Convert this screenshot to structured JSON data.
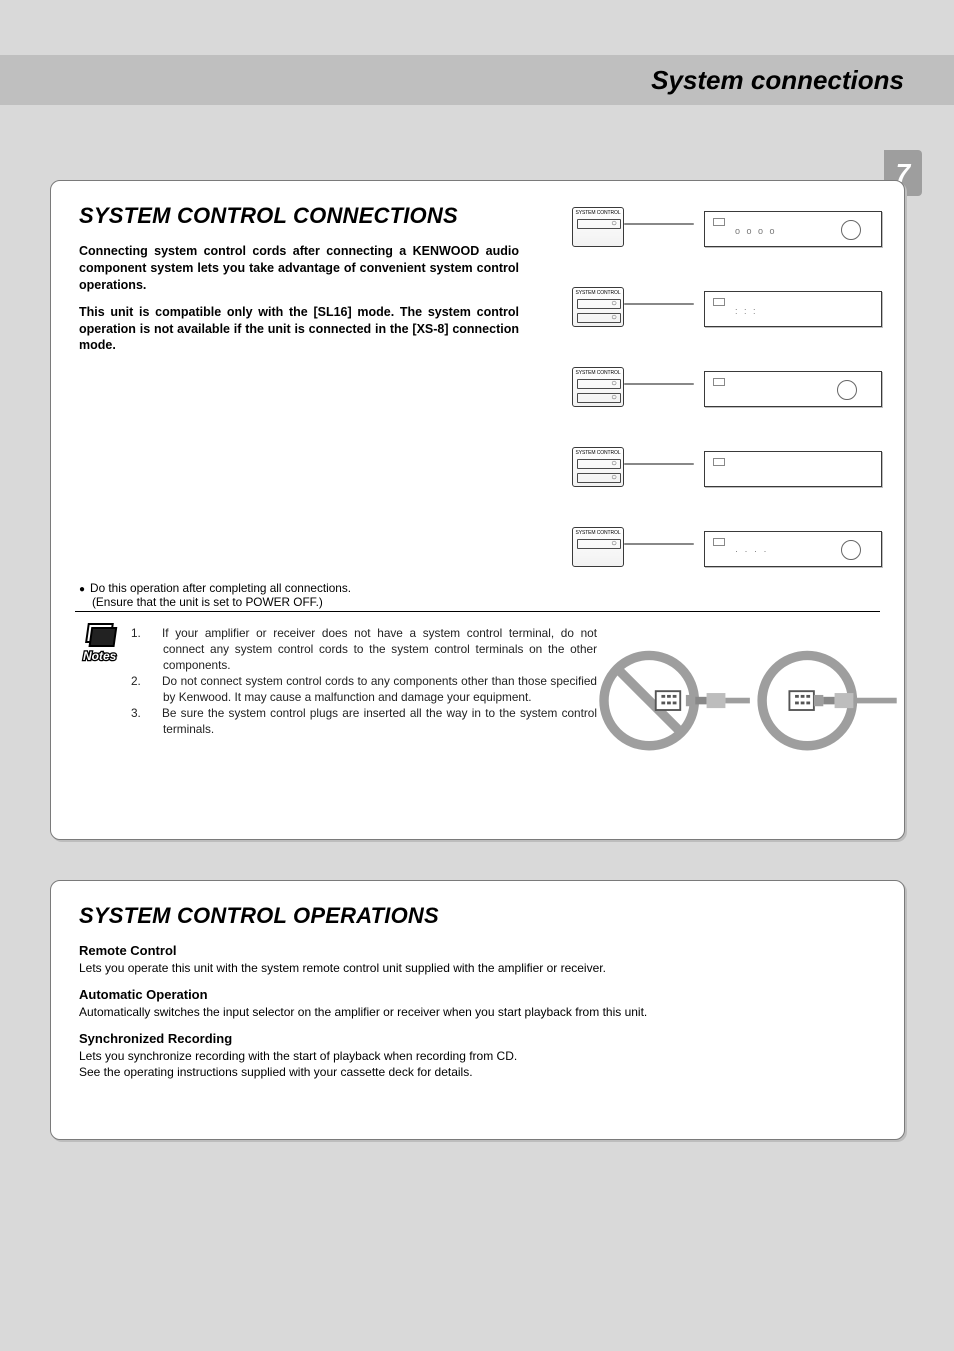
{
  "header": {
    "title": "System connections"
  },
  "page_number": "7",
  "section1": {
    "title": "SYSTEM CONTROL CONNECTIONS",
    "intro1": "Connecting system control cords after connecting a KENWOOD audio component system lets you take advantage of convenient system control operations.",
    "intro2": "This unit is compatible only with the [SL16] mode. The system control operation is not available if the unit is connected in the [XS-8] connection mode.",
    "diag_label": "SYSTEM CONTROL",
    "op_note_line1": "Do this operation after completing all connections.",
    "op_note_line2": "(Ensure that the unit is set to POWER OFF.)",
    "notes": {
      "label": "Notes",
      "items": [
        {
          "n": "1.",
          "t": "If your amplifier or receiver does not have a system control terminal, do not connect any system control cords to the system control terminals on the other components."
        },
        {
          "n": "2.",
          "t": "Do not connect system control cords to any components other than those specified by Kenwood. It may cause a malfunction and damage your equipment."
        },
        {
          "n": "3.",
          "t": "Be sure the system control plugs are inserted all the way in to the system control terminals."
        }
      ]
    }
  },
  "section2": {
    "title": "SYSTEM CONTROL OPERATIONS",
    "items": [
      {
        "h": "Remote Control",
        "p": "Lets you operate this unit with the system remote control unit supplied with the amplifier or receiver."
      },
      {
        "h": "Automatic Operation",
        "p": "Automatically switches the input selector on the amplifier or receiver when you start playback from this unit."
      },
      {
        "h": "Synchronized Recording",
        "p1": "Lets you synchronize recording with the start of playback when recording from CD.",
        "p2": "See the operating instructions supplied with your cassette deck for details."
      }
    ]
  }
}
